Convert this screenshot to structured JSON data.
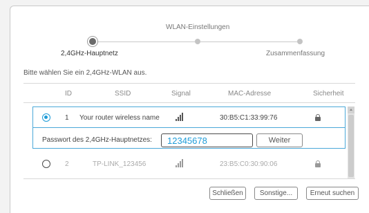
{
  "wizard": {
    "steps": [
      {
        "label": "2,4GHz-Hauptnetz",
        "state": "active"
      },
      {
        "label": "WLAN-Einstellungen",
        "state": "pending"
      },
      {
        "label": "Zusammenfassung",
        "state": "pending"
      }
    ]
  },
  "instruction": "Bitte wählen Sie ein 2,4GHz-WLAN aus.",
  "table": {
    "headers": [
      "ID",
      "SSID",
      "Signal",
      "MAC-Adresse",
      "Sicherheit"
    ],
    "rows": [
      {
        "id": "1",
        "ssid": "Your router wireless name",
        "signal_icon": "signal-strength-icon",
        "mac": "30:B5:C1:33:99:76",
        "security_icon": "lock-icon",
        "selected": true
      },
      {
        "id": "2",
        "ssid": "TP-LINK_123456",
        "signal_icon": "signal-strength-icon",
        "mac": "23:B5:C0:30:90:06",
        "security_icon": "lock-icon",
        "selected": false
      }
    ]
  },
  "password": {
    "label": "Passwort des 2,4GHz-Hauptnetzes:",
    "value": "12345678",
    "next_label": "Weiter"
  },
  "footer": {
    "close_label": "Schließen",
    "other_label": "Sonstige...",
    "rescan_label": "Erneut suchen"
  },
  "colors": {
    "accent": "#1e9cd8",
    "selection_border": "#4aa8d8"
  }
}
